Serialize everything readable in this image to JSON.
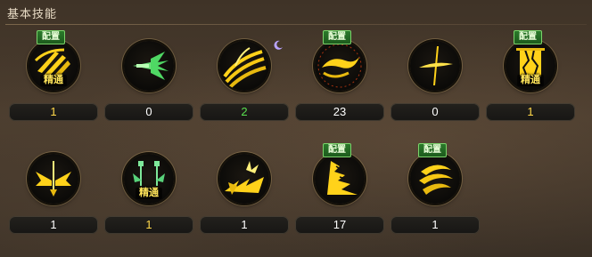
{
  "panel": {
    "title": "基本技能"
  },
  "colors": {
    "level_white": "#ffffff",
    "level_yellow": "#ffd84a",
    "level_green": "#59e04f",
    "icon_gold": "#ffd21a"
  },
  "skills": [
    {
      "icon": "claw-slash-icon",
      "level": "1",
      "level_color": "#ffd84a",
      "config_tag": "配置",
      "master_tag": "精通"
    },
    {
      "icon": "winged-dagger-icon",
      "level": "0",
      "level_color": "#ffffff"
    },
    {
      "icon": "flame-wave-icon",
      "level": "2",
      "level_color": "#59e04f",
      "status_icon": "crescent-moon-icon"
    },
    {
      "icon": "spiral-cut-icon",
      "level": "23",
      "level_color": "#ffffff",
      "config_tag": "配置"
    },
    {
      "icon": "cross-strike-icon",
      "level": "0",
      "level_color": "#ffffff"
    },
    {
      "icon": "shattered-gate-icon",
      "level": "1",
      "level_color": "#ffd84a",
      "config_tag": "配置",
      "master_tag": "精通"
    },
    {
      "icon": "winged-sword-icon",
      "level": "1",
      "level_color": "#ffffff"
    },
    {
      "icon": "twin-pillars-icon",
      "level": "1",
      "level_color": "#ffd84a",
      "master_tag": "精通"
    },
    {
      "icon": "burst-rush-icon",
      "level": "1",
      "level_color": "#ffffff"
    },
    {
      "icon": "layered-slash-icon",
      "level": "17",
      "level_color": "#ffffff",
      "config_tag": "配置"
    },
    {
      "icon": "crescent-swirl-icon",
      "level": "1",
      "level_color": "#ffffff",
      "config_tag": "配置"
    }
  ]
}
